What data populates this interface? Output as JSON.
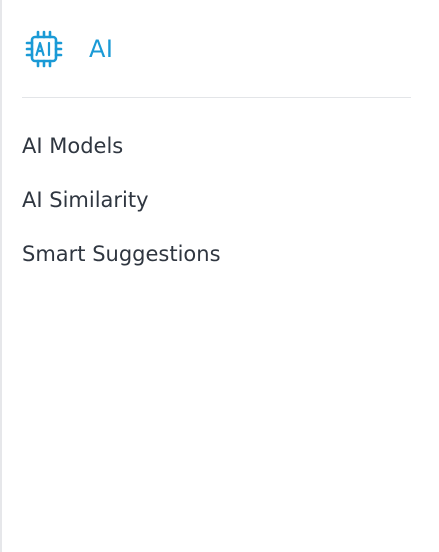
{
  "section": {
    "title": "AI",
    "icon": "ai-chip-icon",
    "accent_color": "#1a9ad6"
  },
  "menu": {
    "items": [
      {
        "label": "AI Models"
      },
      {
        "label": "AI Similarity"
      },
      {
        "label": "Smart Suggestions"
      }
    ]
  }
}
